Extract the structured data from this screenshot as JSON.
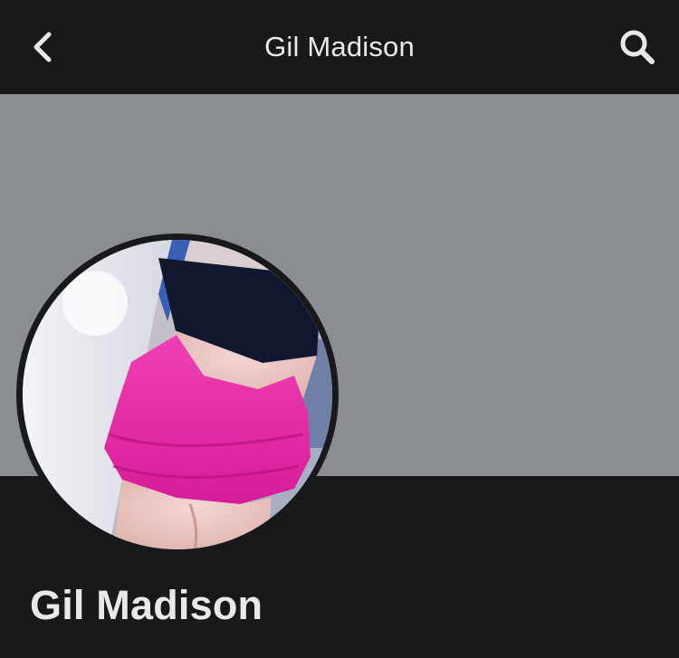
{
  "header": {
    "title": "Gil Madison",
    "back_icon": "chevron-left-icon",
    "search_icon": "search-icon"
  },
  "cover": {
    "color": "#8a8e92"
  },
  "profile": {
    "name": "Gil Madison",
    "avatar_description_icon": "profile-photo"
  },
  "colors": {
    "background": "#18191b",
    "text": "#e8e9eb",
    "cover": "#8a8e92"
  }
}
